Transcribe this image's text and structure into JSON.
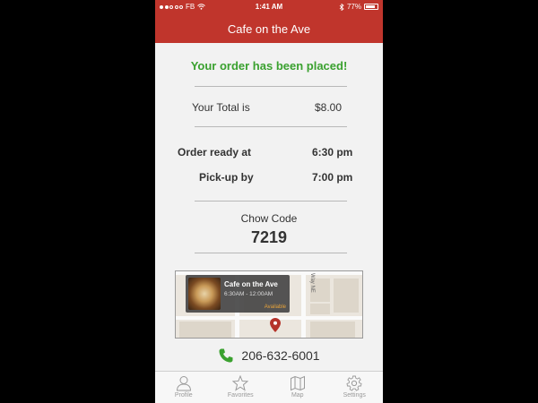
{
  "status_bar": {
    "carrier": "FB",
    "time": "1:41 AM",
    "battery": "77%",
    "battery_level": 0.77
  },
  "header": {
    "title": "Cafe on the Ave"
  },
  "order": {
    "message": "Your order has been placed!",
    "total_label": "Your Total is",
    "total_value": "$8.00",
    "ready_label": "Order ready at",
    "ready_value": "6:30 pm",
    "pickup_label": "Pick-up by",
    "pickup_value": "7:00 pm",
    "chow_label": "Chow Code",
    "chow_code": "7219"
  },
  "map": {
    "popup_title": "Cafe on the Ave",
    "popup_hours": "6:30AM - 12:00AM",
    "popup_status": "Available",
    "street_label": "Way NE"
  },
  "contact": {
    "phone": "206-632-6001"
  },
  "tabs": [
    {
      "label": "Profile",
      "icon": "person-icon"
    },
    {
      "label": "Favorites",
      "icon": "star-icon"
    },
    {
      "label": "Map",
      "icon": "map-icon"
    },
    {
      "label": "Settings",
      "icon": "gear-icon"
    }
  ],
  "colors": {
    "brand": "#c0352c",
    "success": "#3aa12f",
    "phone_icon": "#3aa12f",
    "pin": "#b5332a"
  }
}
